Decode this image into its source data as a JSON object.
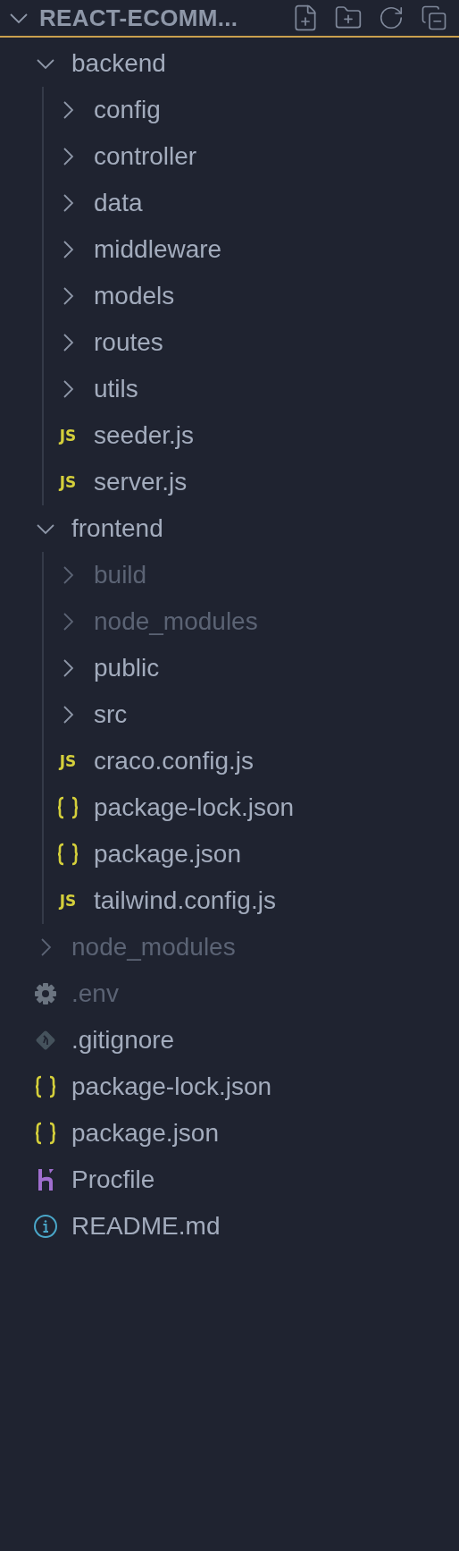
{
  "header": {
    "title": "REACT-ECOMM...",
    "expanded": true
  },
  "tree": [
    {
      "kind": "folder",
      "name": "backend",
      "expanded": true,
      "dimmed": false,
      "children": [
        {
          "kind": "folder",
          "name": "config",
          "expanded": false,
          "dimmed": false
        },
        {
          "kind": "folder",
          "name": "controller",
          "expanded": false,
          "dimmed": false
        },
        {
          "kind": "folder",
          "name": "data",
          "expanded": false,
          "dimmed": false
        },
        {
          "kind": "folder",
          "name": "middleware",
          "expanded": false,
          "dimmed": false
        },
        {
          "kind": "folder",
          "name": "models",
          "expanded": false,
          "dimmed": false
        },
        {
          "kind": "folder",
          "name": "routes",
          "expanded": false,
          "dimmed": false
        },
        {
          "kind": "folder",
          "name": "utils",
          "expanded": false,
          "dimmed": false
        },
        {
          "kind": "js",
          "badge": "JS",
          "name": "seeder.js",
          "dimmed": false
        },
        {
          "kind": "js",
          "badge": "JS",
          "name": "server.js",
          "dimmed": false
        }
      ]
    },
    {
      "kind": "folder",
      "name": "frontend",
      "expanded": true,
      "dimmed": false,
      "children": [
        {
          "kind": "folder",
          "name": "build",
          "expanded": false,
          "dimmed": true
        },
        {
          "kind": "folder",
          "name": "node_modules",
          "expanded": false,
          "dimmed": true
        },
        {
          "kind": "folder",
          "name": "public",
          "expanded": false,
          "dimmed": false
        },
        {
          "kind": "folder",
          "name": "src",
          "expanded": false,
          "dimmed": false
        },
        {
          "kind": "js",
          "badge": "JS",
          "name": "craco.config.js",
          "dimmed": false
        },
        {
          "kind": "json",
          "name": "package-lock.json",
          "dimmed": false
        },
        {
          "kind": "json",
          "name": "package.json",
          "dimmed": false
        },
        {
          "kind": "js",
          "badge": "JS",
          "name": "tailwind.config.js",
          "dimmed": false
        }
      ]
    },
    {
      "kind": "folder",
      "name": "node_modules",
      "expanded": false,
      "dimmed": true
    },
    {
      "kind": "env",
      "name": ".env",
      "dimmed": true
    },
    {
      "kind": "git",
      "name": ".gitignore",
      "dimmed": false
    },
    {
      "kind": "json",
      "name": "package-lock.json",
      "dimmed": false
    },
    {
      "kind": "json",
      "name": "package.json",
      "dimmed": false
    },
    {
      "kind": "heroku",
      "name": "Procfile",
      "dimmed": false
    },
    {
      "kind": "info",
      "name": "README.md",
      "dimmed": false
    }
  ]
}
